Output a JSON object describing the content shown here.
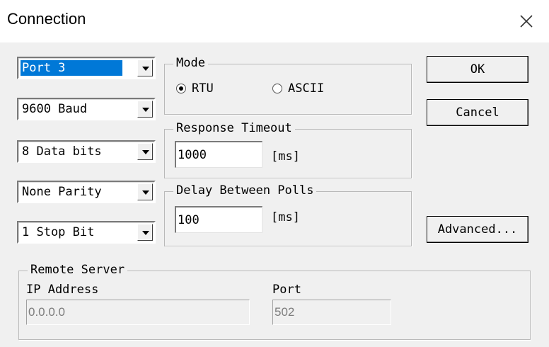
{
  "window": {
    "title": "Connection",
    "close_icon": "close-icon"
  },
  "serial": {
    "port": "Port 3",
    "baud": "9600 Baud",
    "data_bits": "8 Data bits",
    "parity": "None Parity",
    "stop_bits": "1 Stop Bit"
  },
  "mode": {
    "label": "Mode",
    "options": [
      {
        "label": "RTU",
        "selected": true
      },
      {
        "label": "ASCII",
        "selected": false
      }
    ]
  },
  "response_timeout": {
    "label": "Response Timeout",
    "value": "1000",
    "unit": "[ms]"
  },
  "delay_between_polls": {
    "label": "Delay Between Polls",
    "value": "100",
    "unit": "[ms]"
  },
  "buttons": {
    "ok": "OK",
    "cancel": "Cancel",
    "advanced": "Advanced..."
  },
  "remote_server": {
    "label": "Remote Server",
    "ip_label": "IP Address",
    "ip_value": "0.0.0.0",
    "port_label": "Port",
    "port_value": "502"
  },
  "colors": {
    "selection": "#0078d7",
    "dialog_bg": "#f0f0f0"
  }
}
